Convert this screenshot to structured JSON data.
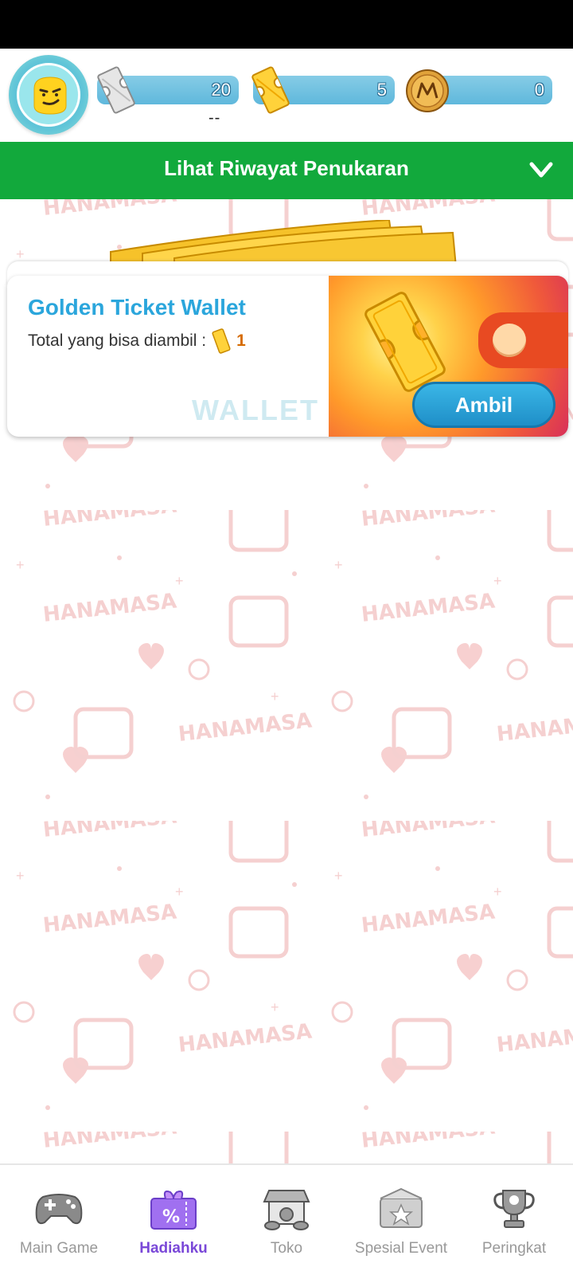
{
  "header": {
    "silver_ticket": {
      "value": "20",
      "sub": "--",
      "icon": "silver-ticket-icon"
    },
    "golden_ticket": {
      "value": "5",
      "icon": "golden-ticket-icon"
    },
    "coin": {
      "value": "0",
      "icon": "m-coin-icon"
    },
    "avatar_icon": "smirk-face-avatar"
  },
  "history": {
    "label": "Lihat Riwayat Penukaran",
    "icon": "chevron-down-icon"
  },
  "wallet": {
    "title": "Golden Ticket Wallet",
    "subtitle": "Total yang bisa diambil :",
    "count": "1",
    "watermark": "WALLET",
    "button": "Ambil"
  },
  "background": {
    "brand_text": "HANAMASA"
  },
  "nav": {
    "items": [
      {
        "label": "Main Game",
        "icon": "gamepad-icon",
        "active": false
      },
      {
        "label": "Hadiahku",
        "icon": "gift-coupon-icon",
        "active": true
      },
      {
        "label": "Toko",
        "icon": "shop-icon",
        "active": false
      },
      {
        "label": "Spesial Event",
        "icon": "event-icon",
        "active": false
      },
      {
        "label": "Peringkat",
        "icon": "trophy-icon",
        "active": false
      }
    ]
  },
  "colors": {
    "history_bar": "#12a93c",
    "stat_bar": "#5fb8dc",
    "wallet_title": "#2ba6dc",
    "active_nav": "#7a48d8",
    "pattern": "#f3c8c8"
  }
}
